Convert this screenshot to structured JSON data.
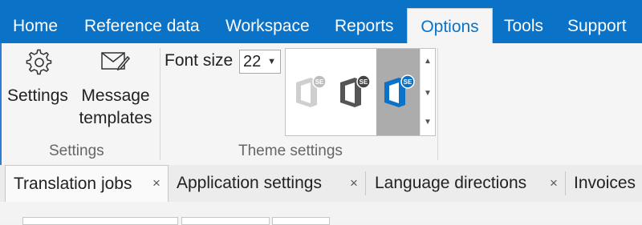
{
  "menu": {
    "tabs": [
      {
        "label": "Home"
      },
      {
        "label": "Reference data"
      },
      {
        "label": "Workspace"
      },
      {
        "label": "Reports"
      },
      {
        "label": "Options",
        "active": true
      },
      {
        "label": "Tools"
      },
      {
        "label": "Support"
      }
    ]
  },
  "ribbon": {
    "settings_group": {
      "settings_label": "Settings",
      "message_label_line1": "Message",
      "message_label_line2": "templates",
      "group_label": "Settings",
      "icons": [
        "gear-icon",
        "envelope-edit-icon"
      ]
    },
    "theme_group": {
      "font_size_label": "Font size",
      "font_size_value": "22",
      "group_label": "Theme settings",
      "themes": [
        {
          "name": "light-theme-icon",
          "badge": "SE",
          "color": "#c8c8c8"
        },
        {
          "name": "dark-theme-icon",
          "badge": "SE",
          "color": "#555555"
        },
        {
          "name": "blue-theme-icon",
          "badge": "SE",
          "color": "#0a72c7",
          "selected": true
        }
      ]
    }
  },
  "doc_tabs": [
    {
      "label": "Translation jobs",
      "active": true,
      "close": "×"
    },
    {
      "label": "Application settings",
      "close": "×"
    },
    {
      "label": "Language directions",
      "close": "×"
    },
    {
      "label": "Invoices"
    }
  ],
  "colors": {
    "accent": "#0a72c7",
    "ribbon_bg": "#f5f5f5",
    "selected_theme_bg": "#acacac"
  }
}
